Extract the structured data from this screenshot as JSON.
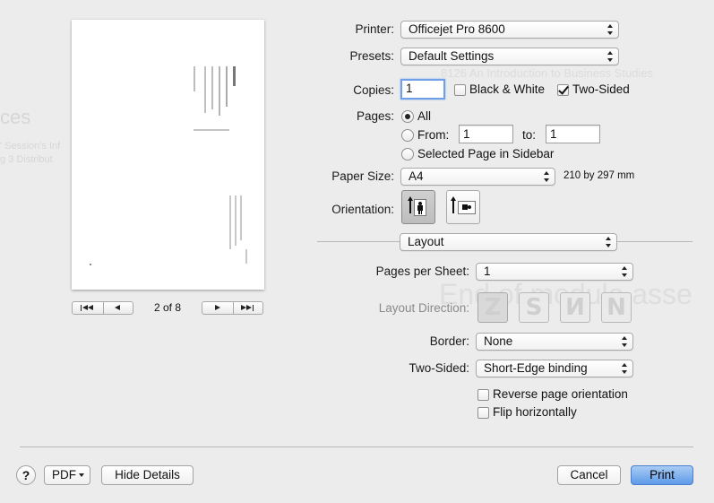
{
  "background_text": {
    "left_big": "ces",
    "left_line1": "' Session's Inf",
    "left_line2": "g 3 Distribut",
    "behind_presets": "8126 An Introduction to Business Studies",
    "behind_layout": "End of module asse"
  },
  "printer": {
    "label": "Printer:",
    "value": "Officejet Pro 8600"
  },
  "presets": {
    "label": "Presets:",
    "value": "Default Settings"
  },
  "copies": {
    "label": "Copies:",
    "value": "1"
  },
  "black_white": {
    "label": "Black & White",
    "checked": false
  },
  "two_sided_check": {
    "label": "Two-Sided",
    "checked": true
  },
  "pages": {
    "label": "Pages:",
    "all_label": "All",
    "from_label": "From:",
    "from_value": "1",
    "to_label": "to:",
    "to_value": "1",
    "sidebar_label": "Selected Page in Sidebar",
    "selected": "All"
  },
  "paper_size": {
    "label": "Paper Size:",
    "value": "A4",
    "dimensions": "210 by 297 mm"
  },
  "orientation": {
    "label": "Orientation:",
    "selected": "portrait"
  },
  "section_popup": {
    "value": "Layout"
  },
  "layout": {
    "pages_per_sheet_label": "Pages per Sheet:",
    "pages_per_sheet_value": "1",
    "direction_label": "Layout Direction:",
    "border_label": "Border:",
    "border_value": "None",
    "two_sided_label": "Two-Sided:",
    "two_sided_value": "Short-Edge binding",
    "reverse_label": "Reverse page orientation",
    "reverse_checked": false,
    "flip_label": "Flip horizontally",
    "flip_checked": false
  },
  "preview": {
    "page_indicator": "2 of 8"
  },
  "footer": {
    "help": "?",
    "pdf": "PDF",
    "hide_details": "Hide Details",
    "cancel": "Cancel",
    "print": "Print"
  },
  "colors": {
    "accent": "#5e9ae8",
    "background": "#ececec"
  },
  "icons": [
    "first-page-icon",
    "prev-page-icon",
    "next-page-icon",
    "last-page-icon",
    "portrait-icon",
    "landscape-icon",
    "help-icon",
    "dropdown-arrow-icon"
  ]
}
